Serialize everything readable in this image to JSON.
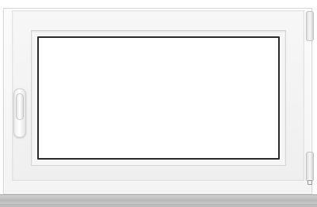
{
  "scene": {
    "subject": "window",
    "colors": {
      "frame": "#f3f3f3",
      "glass": "#ffffff",
      "glass_border": "#2b2b2b",
      "sill": "#bdbdbd",
      "hardware": "#d0d0d0"
    },
    "icons": {
      "handle": "window-handle-icon",
      "hinge": "hinge-icon"
    }
  }
}
